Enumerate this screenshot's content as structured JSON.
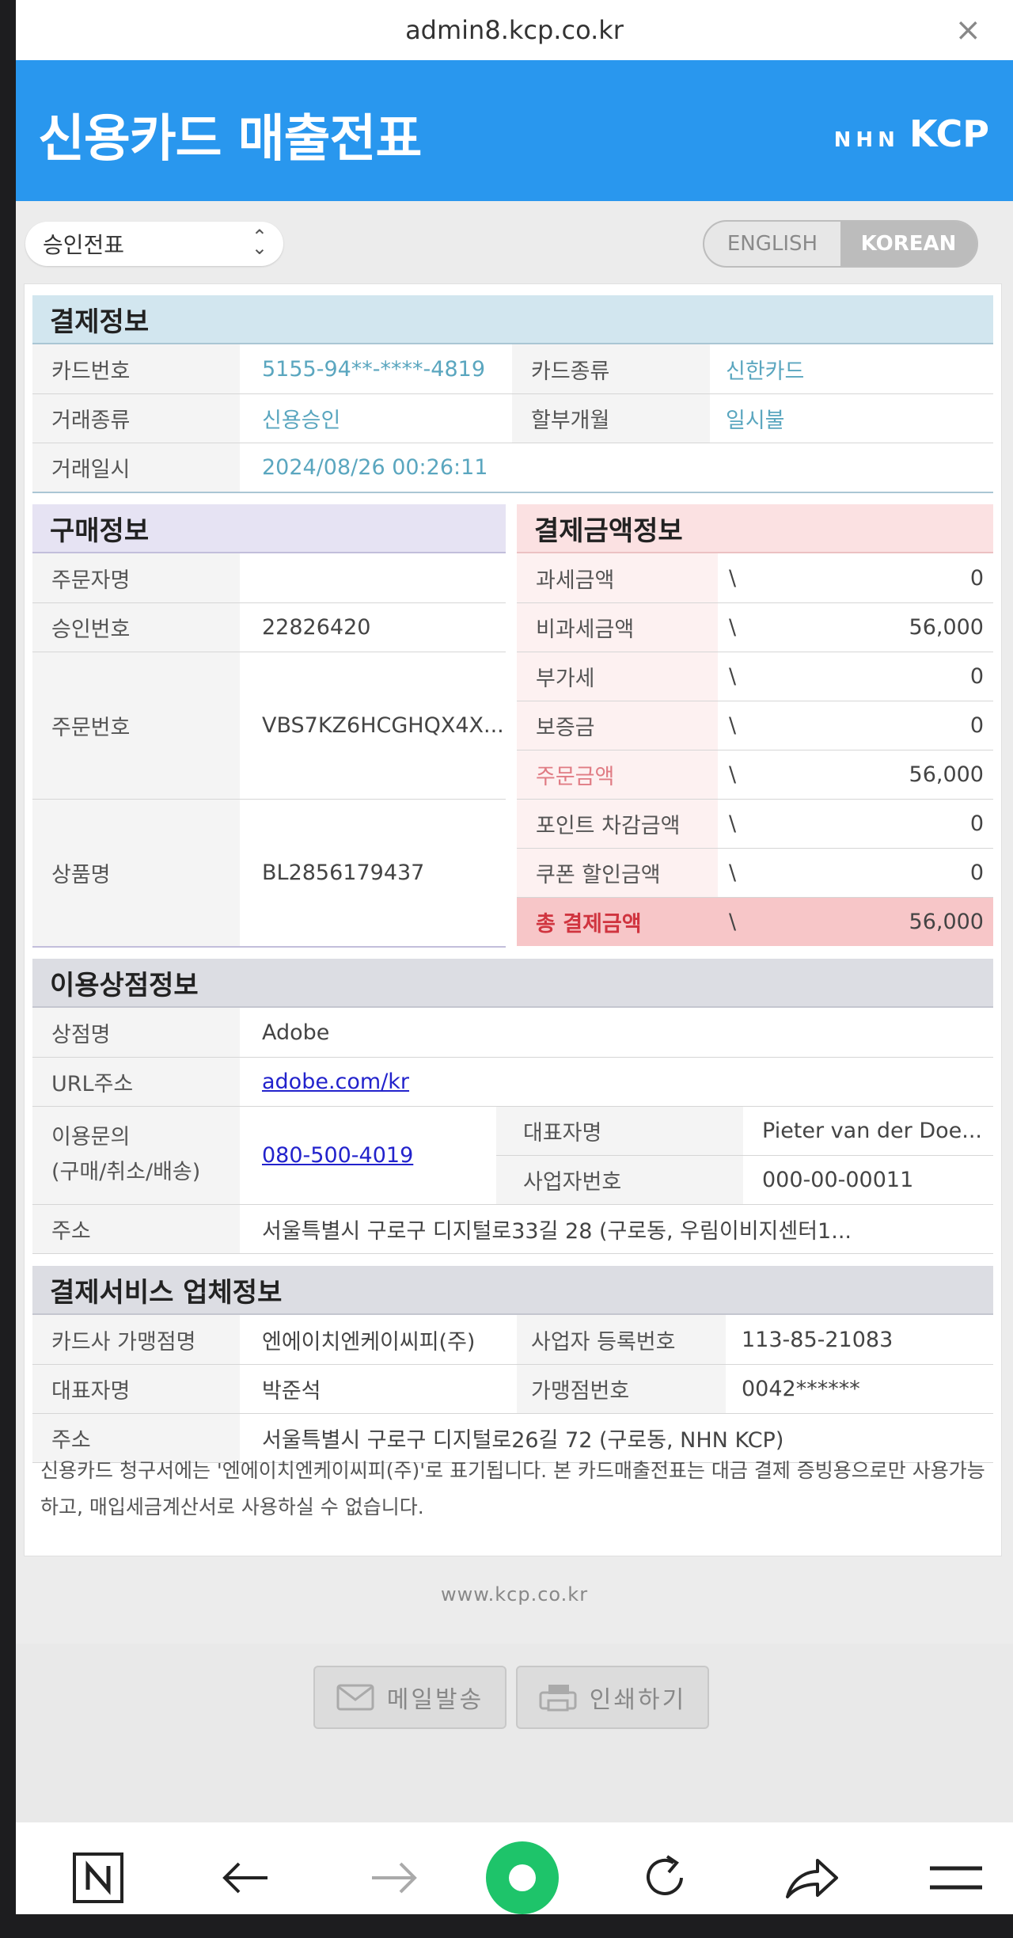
{
  "browser": {
    "url": "admin8.kcp.co.kr",
    "close_icon": "×"
  },
  "header": {
    "title": "신용카드 매출전표",
    "brand_nhn": "NHN",
    "brand_kcp": "KCP",
    "color": "#2997ee"
  },
  "toolbar": {
    "select_value": "승인전표",
    "lang_en": "ENGLISH",
    "lang_ko": "KOREAN"
  },
  "payment": {
    "title": "결제정보",
    "card_no_label": "카드번호",
    "card_no": "5155-94**-****-4819",
    "card_type_label": "카드종류",
    "card_type": "신한카드",
    "trans_type_label": "거래종류",
    "trans_type": "신용승인",
    "install_label": "할부개월",
    "install": "일시불",
    "trans_date_label": "거래일시",
    "trans_date": "2024/08/26 00:26:11"
  },
  "purchase": {
    "title": "구매정보",
    "buyer_label": "주문자명",
    "buyer": "",
    "approval_label": "승인번호",
    "approval": "22826420",
    "order_label": "주문번호",
    "order": "VBS7KZ6HCGHQX4X...",
    "product_label": "상품명",
    "product": "BL2856179437"
  },
  "amount": {
    "title": "결제금액정보",
    "currency": "\\",
    "rows": [
      {
        "label": "과세금액",
        "value": "0"
      },
      {
        "label": "비과세금액",
        "value": "56,000"
      },
      {
        "label": "부가세",
        "value": "0"
      },
      {
        "label": "보증금",
        "value": "0"
      },
      {
        "label": "주문금액",
        "value": "56,000"
      },
      {
        "label": "포인트 차감금액",
        "value": "0"
      },
      {
        "label": "쿠폰 할인금액",
        "value": "0"
      }
    ],
    "total_label": "총 결제금액",
    "total_value": "56,000"
  },
  "merchant": {
    "title": "이용상점정보",
    "shop_label": "상점명",
    "shop": "Adobe",
    "url_label": "URL주소",
    "url": "adobe.com/kr",
    "contact_label1": "이용문의",
    "contact_label2": "(구매/취소/배송)",
    "contact": "080-500-4019",
    "ceo_label": "대표자명",
    "ceo": "Pieter van der Doe...",
    "biz_label": "사업자번호",
    "biz": "000-00-00011",
    "addr_label": "주소",
    "addr": "서울특별시 구로구 디지털로33길 28 (구로동, 우림이비지센터1..."
  },
  "pg": {
    "title": "결제서비스 업체정보",
    "merchant_label": "카드사 가맹점명",
    "merchant": "엔에이치엔케이씨피(주)",
    "reg_label": "사업자 등록번호",
    "reg": "113-85-21083",
    "ceo_label": "대표자명",
    "ceo": "박준석",
    "store_label": "가맹점번호",
    "store": "0042******",
    "addr_label": "주소",
    "addr": "서울특별시 구로구 디지털로26길 72 (구로동, NHN KCP)"
  },
  "notice": "신용카드 청구서에는 '엔에이치엔케이씨피(주)'로 표기됩니다. 본 카드매출전표는 대금 결제 증빙용으로만 사용가능하고, 매입세금계산서로 사용하실 수 없습니다.",
  "footer": "www.kcp.co.kr",
  "buttons": {
    "mail": "메일발송",
    "print": "인쇄하기"
  }
}
